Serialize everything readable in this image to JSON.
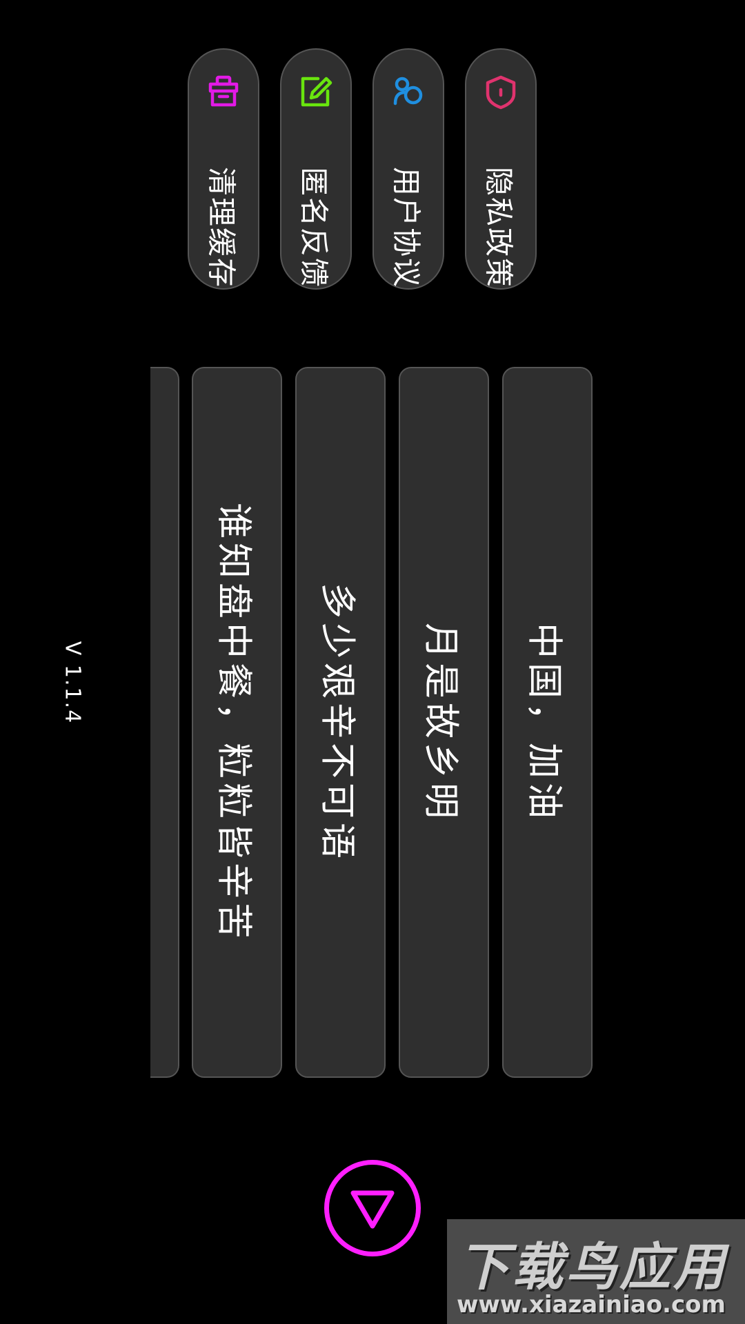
{
  "menu": [
    {
      "label": "清理缓存",
      "icon": "cleaner-icon",
      "color": "#e21ae6"
    },
    {
      "label": "匿名反馈",
      "icon": "edit-feedback-icon",
      "color": "#69e50e"
    },
    {
      "label": "用户协议",
      "icon": "users-agreement-icon",
      "color": "#1f8fe0"
    },
    {
      "label": "隐私政策",
      "icon": "privacy-shield-icon",
      "color": "#e0336e"
    }
  ],
  "cards": [
    {
      "text": "谁知盘中餐，粒粒皆辛苦"
    },
    {
      "text": "多少艰辛不可语"
    },
    {
      "text": "月是故乡明"
    },
    {
      "text": "中国，加油"
    }
  ],
  "version": "V 1.1.4",
  "play": {
    "icon": "play-triangle-icon",
    "color": "#ff1fff"
  },
  "watermark": {
    "title": "下载鸟应用",
    "url": "www.xiazainiao.com"
  }
}
